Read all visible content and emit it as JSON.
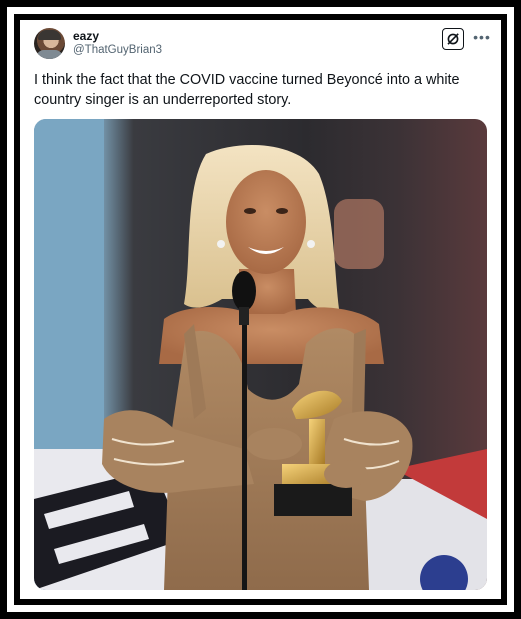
{
  "tweet": {
    "author": {
      "display_name": "eazy",
      "handle": "@ThatGuyBrian3"
    },
    "text": "I think the fact that the COVID vaccine turned Beyoncé into a white country singer is an underreported story.",
    "actions": {
      "grok_icon": "grok-icon",
      "more_icon": "more-icon"
    }
  },
  "colors": {
    "text_primary": "#0f1419",
    "text_secondary": "#536471",
    "frame": "#000000"
  }
}
